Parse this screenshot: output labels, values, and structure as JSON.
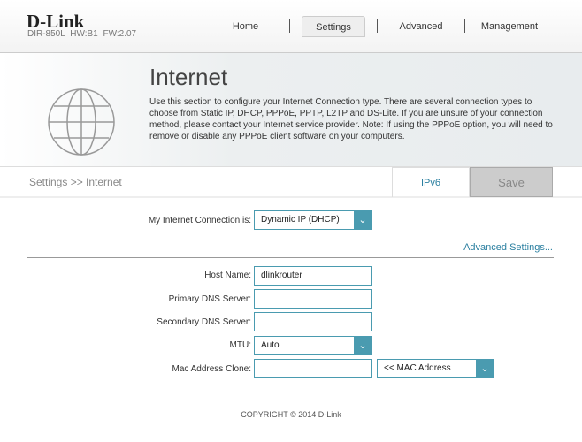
{
  "header": {
    "logo": "D-Link",
    "model": "DIR-850L",
    "hw": "HW:B1",
    "fw": "FW:2.07",
    "nav": [
      {
        "label": "Home"
      },
      {
        "label": "Settings",
        "active": true
      },
      {
        "label": "Advanced"
      },
      {
        "label": "Management"
      }
    ]
  },
  "banner": {
    "title": "Internet",
    "description": "Use this section to configure your Internet Connection type. There are several connection types to choose from Static IP, DHCP, PPPoE, PPTP, L2TP and DS-Lite. If you are unsure of your connection method, please contact your Internet service provider. Note: If using the PPPoE option, you will need to remove or disable any PPPoE client software on your computers."
  },
  "toolbar": {
    "breadcrumb": "Settings >> Internet",
    "ipv6": "IPv6",
    "save": "Save"
  },
  "form": {
    "connection_label": "My Internet Connection is:",
    "connection_value": "Dynamic IP (DHCP)",
    "advanced_link": "Advanced Settings...",
    "host_label": "Host Name:",
    "host_value": "dlinkrouter",
    "dns1_label": "Primary DNS Server:",
    "dns1_value": "",
    "dns2_label": "Secondary DNS Server:",
    "dns2_value": "",
    "mtu_label": "MTU:",
    "mtu_value": "Auto",
    "mac_label": "Mac Address Clone:",
    "mac_value": "",
    "mac_select": "<< MAC Address"
  },
  "footer": {
    "copyright": "COPYRIGHT © 2014 D-Link"
  },
  "colors": {
    "accent": "#4a9bb0",
    "link": "#2a7fa0"
  }
}
